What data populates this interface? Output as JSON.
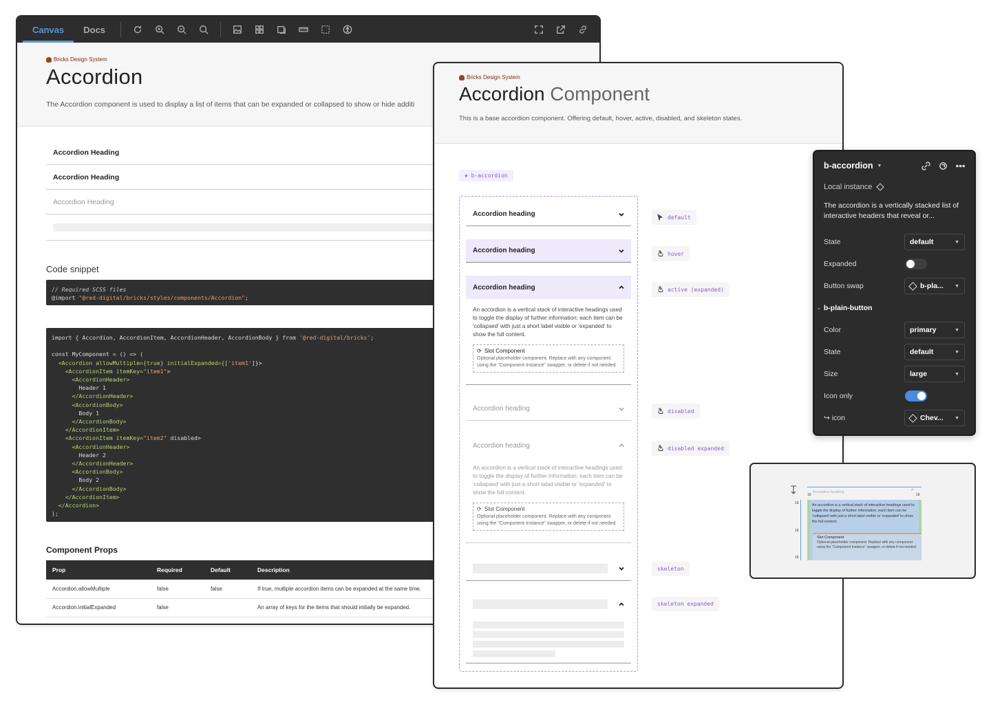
{
  "docs": {
    "tabs": [
      "Canvas",
      "Docs"
    ],
    "brand": "Bricks Design System",
    "title": "Accordion",
    "description": "The Accordion component is used to display a list of items that can be expanded or collapsed to show or hide additi",
    "accordion_items": [
      "Accordion Heading",
      "Accordion Heading",
      "Accordion Heading"
    ],
    "code_snippet_title": "Code snippet",
    "code1": {
      "comment": "// Required SCSS files",
      "import_kw": "@import",
      "path": "\"@red-digital/bricks/styles/components/Accordion\"",
      "end": ";"
    },
    "code2": [
      "import { Accordion, AccordionItem, AccordionHeader, AccordionBody } from '@red-digital/bricks';",
      "",
      "const MyComponent = () => (",
      "  <Accordion allowMultiple={true} initialExpanded={['item1']}>",
      "    <AccordionItem itemKey=\"item1\">",
      "      <AccordionHeader>",
      "        Header 1",
      "      </AccordionHeader>",
      "      <AccordionBody>",
      "        Body 1",
      "      </AccordionBody>",
      "    </AccordionItem>",
      "    <AccordionItem itemKey=\"item2\" disabled>",
      "      <AccordionHeader>",
      "        Header 2",
      "      </AccordionHeader>",
      "      <AccordionBody>",
      "        Body 2",
      "      </AccordionBody>",
      "    </AccordionItem>",
      "  </Accordion>",
      ");"
    ],
    "props_title": "Component Props",
    "props_headers": [
      "Prop",
      "Required",
      "Default",
      "Description"
    ],
    "props_rows": [
      [
        "Accordion.allowMultiple",
        "false",
        "false",
        "If true, multiple accordion items can be expanded at the same time."
      ],
      [
        "Accordion.initialExpanded",
        "false",
        "",
        "An array of keys for the items that should initially be expanded."
      ]
    ]
  },
  "figma": {
    "brand": "Bricks Design System",
    "title_main": "Accordion",
    "title_light": "Component",
    "description": "This is a base accordion component. Offering default, hover, active, disabled, and skeleton states.",
    "component_label": "b-accordion",
    "heading": "Accordion heading",
    "body_text": "An accordion is a vertical stack of interactive headings used to toggle the display of further information; each item can be 'collapsed' with just a short label visible or 'expanded' to show the full content.",
    "slot_title": "Slot Component",
    "slot_text": "Optional placeholder component. Replace with any component using the \"Component Instance\" swapper, or delete if not needed",
    "states": [
      "default",
      "hover",
      "active (expanded)",
      "disabled",
      "disabled expanded",
      "skeleton",
      "skeleton expanded"
    ]
  },
  "panel": {
    "title": "b-accordion",
    "local_instance": "Local instance",
    "description": "The accordion is a vertically stacked list of interactive headers that reveal or...",
    "state_label": "State",
    "state_value": "default",
    "expanded_label": "Expanded",
    "expanded": false,
    "button_swap_label": "Button swap",
    "button_swap_value": "b-pla...",
    "sub_title": "b-plain-button",
    "color_label": "Color",
    "color_value": "primary",
    "state2_label": "State",
    "state2_value": "default",
    "size_label": "Size",
    "size_value": "large",
    "icon_only_label": "Icon only",
    "icon_only": true,
    "icon_label": "icon",
    "icon_value": "Chev..."
  },
  "preview": {
    "heading": "Accordion heading",
    "body_text": "An accordion is a vertical stack of interactive headings used to toggle the display of further information; each item can be 'collapsed' with just a short label visible or 'expanded' to show the full content.",
    "slot_title": "Slot Component",
    "slot_text": "Optional placeholder component. Replace with any component using the \"Component Instance\" swapper, or delete if not needed.",
    "spacing_labels": [
      "16",
      "16",
      "16",
      "16",
      "16"
    ]
  },
  "colors": {
    "accent": "#5b93d6",
    "figma_purple": "#8a5ad1",
    "toggle_on": "#4b8ae0"
  }
}
